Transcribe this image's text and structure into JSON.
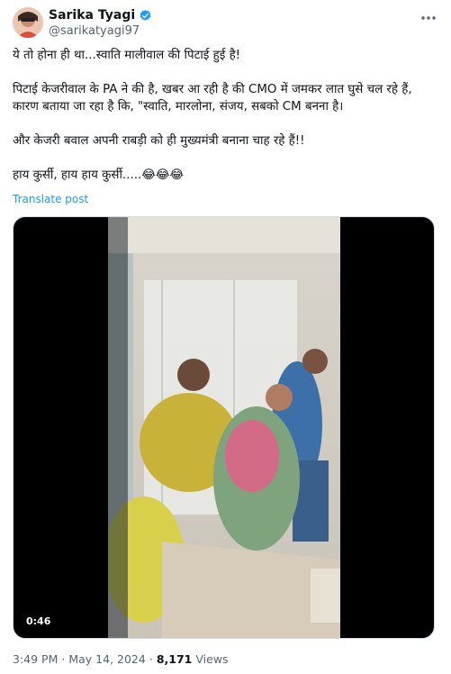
{
  "author": {
    "display_name": "Sarika Tyagi",
    "handle": "@sarikatyagi97",
    "verified": true
  },
  "tweet": {
    "paragraphs": [
      "ये तो होना ही था...स्वाति मालीवाल की पिटाई हुई है!",
      "पिटाई केजरीवाल के PA ने की है, खबर आ रही है की CMO में जमकर लात घुसे चल रहे हैं, कारण बताया जा रहा है कि, \"स्वाति, मारलोना, संजय, सबको CM बनना है।",
      "और केजरी बवाल अपनी राबड़ी को ही मुख्यमंत्री बनाना चाह रहे हैं!!",
      "हाय कुर्सी, हाय हाय कुर्सी.....😂😂😂"
    ],
    "translate_label": "Translate post"
  },
  "media": {
    "duration": "0:46"
  },
  "meta": {
    "time": "3:49 PM",
    "separator": "·",
    "date": "May 14, 2024",
    "views_count": "8,171",
    "views_label": "Views"
  },
  "icons": {
    "more": "more-options-icon",
    "verified": "verified-badge-icon"
  },
  "colors": {
    "link": "#1d9bf0",
    "secondary_text": "#536471"
  }
}
